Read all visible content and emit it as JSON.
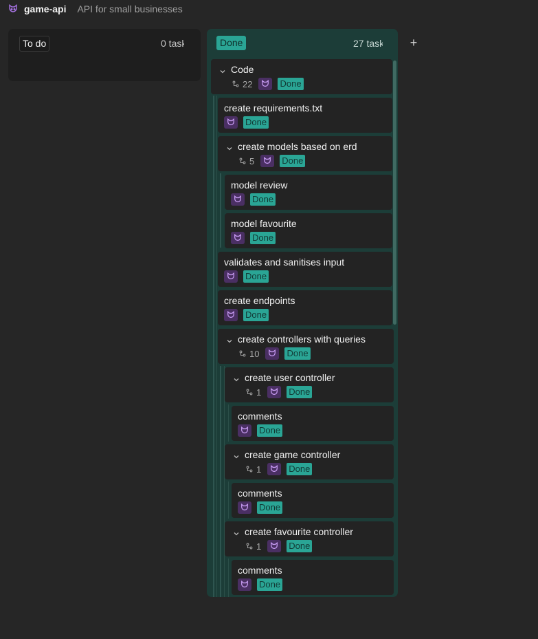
{
  "header": {
    "project_icon": "cat-face-icon",
    "project_name": "game-api",
    "project_description": "API for small businesses"
  },
  "columns": {
    "todo": {
      "label": "To do",
      "count": "0 task"
    },
    "done": {
      "label": "Done",
      "count": "27 task"
    },
    "add_icon": "+"
  },
  "colors": {
    "background": "#262626",
    "done_column": "#1c3d38",
    "status_done": "#2aa595",
    "avatar_bg": "#4a2f63",
    "avatar_fg": "#c79bf2"
  },
  "cards": [
    {
      "title": "Code",
      "subtasks": "22",
      "status": "Done",
      "expanded": true
    },
    {
      "title": "create requirements.txt",
      "status": "Done"
    },
    {
      "title": "create models based on erd",
      "subtasks": "5",
      "status": "Done",
      "expanded": true
    },
    {
      "title": "model review",
      "status": "Done"
    },
    {
      "title": "model favourite",
      "status": "Done"
    },
    {
      "title": "validates and sanitises input",
      "status": "Done"
    },
    {
      "title": "create endpoints",
      "status": "Done"
    },
    {
      "title": "create controllers with queries",
      "subtasks": "10",
      "status": "Done",
      "expanded": true
    },
    {
      "title": "create user controller",
      "subtasks": "1",
      "status": "Done",
      "expanded": true
    },
    {
      "title": "comments",
      "status": "Done"
    },
    {
      "title": "create game controller",
      "subtasks": "1",
      "status": "Done",
      "expanded": true
    },
    {
      "title": "comments",
      "status": "Done"
    },
    {
      "title": "create favourite controller",
      "subtasks": "1",
      "status": "Done",
      "expanded": true
    },
    {
      "title": "comments",
      "status": "Done"
    }
  ]
}
